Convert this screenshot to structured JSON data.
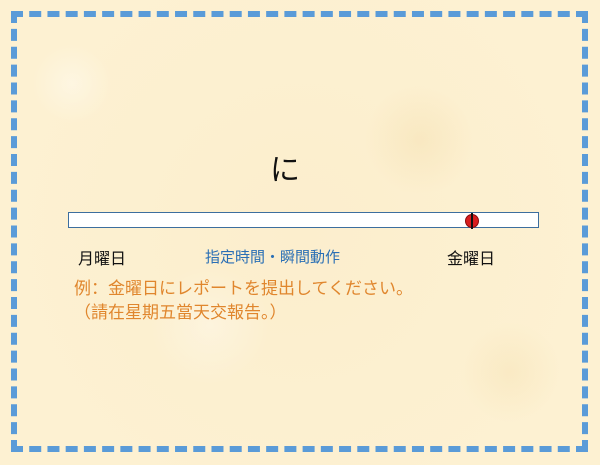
{
  "slide": {
    "center_char": "に",
    "timeline": {
      "start_label": "月曜日",
      "end_label": "金曜日",
      "middle_label": "指定時間・瞬間動作",
      "marker_position": 0.86,
      "marker_color": "#d81e1e"
    },
    "example": "例：金曜日にレポートを提出してください。",
    "translation": "（請在星期五當天交報告。）",
    "colors": {
      "frame": "#5a9bd8",
      "middle_label": "#2a6fb5",
      "example_text": "#e0862d"
    }
  }
}
